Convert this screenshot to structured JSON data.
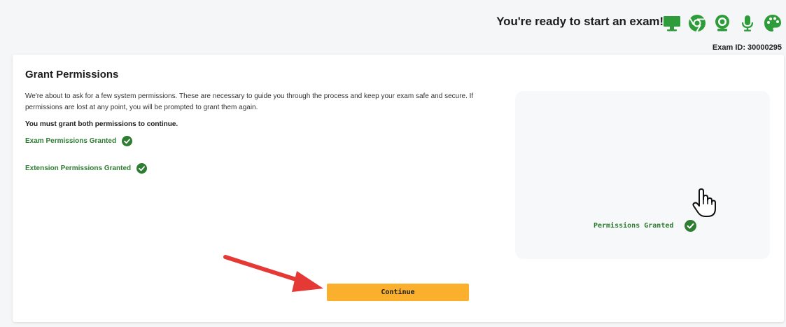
{
  "header": {
    "ready_text": "You're ready to start an exam!",
    "exam_id": "Exam ID: 30000295",
    "icons": [
      "monitor-icon",
      "chrome-icon",
      "webcam-icon",
      "microphone-icon",
      "palette-icon"
    ],
    "icon_color": "#2e9c3a"
  },
  "card": {
    "title": "Grant Permissions",
    "intro": "We're about to ask for a few system permissions. These are necessary to guide you through the process and keep your exam safe and secure. If permissions are lost at any point, you will be prompted to grant them again.",
    "must_text": "You must grant both permissions to continue.",
    "permissions": [
      {
        "label": "Exam Permissions Granted",
        "icon": "check-circle-icon"
      },
      {
        "label": "Extension Permissions Granted",
        "icon": "check-circle-icon"
      }
    ],
    "preview_status": "Permissions Granted",
    "continue_label": "Continue"
  },
  "colors": {
    "accent": "#fbb02d",
    "success": "#2e7d32",
    "arrow": "#e53935"
  }
}
